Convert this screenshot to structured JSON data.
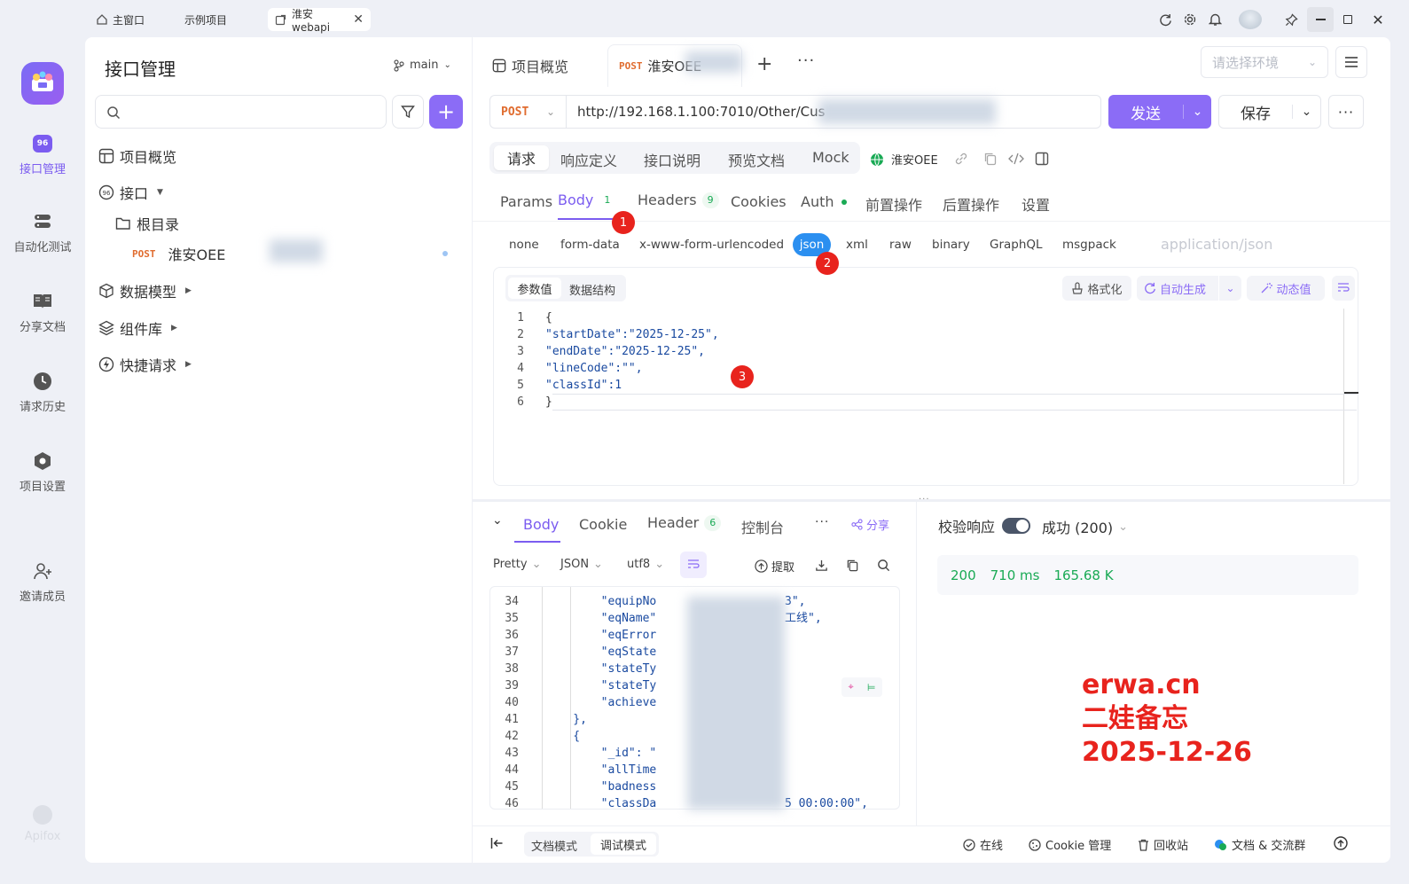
{
  "titlebar": {
    "tabs": [
      {
        "label": "主窗口"
      },
      {
        "label": "示例项目"
      },
      {
        "label": "淮安webapi"
      }
    ]
  },
  "rail": {
    "items": [
      {
        "label": "接口管理",
        "icon": "api-icon"
      },
      {
        "label": "自动化测试",
        "icon": "database-icon"
      },
      {
        "label": "分享文档",
        "icon": "book-icon"
      },
      {
        "label": "请求历史",
        "icon": "clock-icon"
      },
      {
        "label": "项目设置",
        "icon": "hexagon-icon"
      },
      {
        "label": "邀请成员",
        "icon": "add-user-icon"
      }
    ],
    "brand": "Apifox",
    "api_badge": "96"
  },
  "sidebar": {
    "title": "接口管理",
    "branch": "main",
    "tree": {
      "overview": "项目概览",
      "api": "接口",
      "root": "根目录",
      "request_method": "POST",
      "request_name": "淮安OEE",
      "data_model": "数据模型",
      "components": "组件库",
      "quick": "快捷请求"
    }
  },
  "top": {
    "overview_tab": "项目概览",
    "active_tab_method": "POST",
    "active_tab_name": "淮安OEE",
    "env_placeholder": "请选择环境"
  },
  "request": {
    "method": "POST",
    "url": "http://192.168.1.100:7010/Other/Cus",
    "send": "发送",
    "save": "保存",
    "mode_tabs": [
      "请求",
      "响应定义",
      "接口说明",
      "预览文档",
      "Mock"
    ],
    "env_name": "淮安OEE",
    "param_tabs": {
      "params": "Params",
      "body": "Body",
      "body_count": "1",
      "headers": "Headers",
      "headers_count": "9",
      "cookies": "Cookies",
      "auth": "Auth",
      "pre": "前置操作",
      "post": "后置操作",
      "settings": "设置"
    },
    "body_types": [
      "none",
      "form-data",
      "x-www-form-urlencoded",
      "json",
      "xml",
      "raw",
      "binary",
      "GraphQL",
      "msgpack"
    ],
    "content_type": "application/json",
    "editor_tabs": {
      "values": "参数值",
      "schema": "数据结构"
    },
    "editor_tools": {
      "format": "格式化",
      "auto": "自动生成",
      "dynamic": "动态值"
    },
    "code": [
      {
        "n": "1",
        "t": "{"
      },
      {
        "n": "2",
        "t": "\"startDate\":\"2025-12-25\","
      },
      {
        "n": "3",
        "t": "\"endDate\":\"2025-12-25\","
      },
      {
        "n": "4",
        "t": "\"lineCode\":\"\","
      },
      {
        "n": "5",
        "t": "\"classId\":1"
      },
      {
        "n": "6",
        "t": "}"
      }
    ]
  },
  "annotations": [
    "1",
    "2",
    "3"
  ],
  "response": {
    "tabs": {
      "body": "Body",
      "cookie": "Cookie",
      "header": "Header",
      "header_count": "6",
      "console": "控制台",
      "share": "分享"
    },
    "options": {
      "pretty": "Pretty",
      "format": "JSON",
      "encoding": "utf8",
      "extract": "提取"
    },
    "code": [
      {
        "n": "34",
        "t": "        \"equipNo",
        "tail": "3\","
      },
      {
        "n": "35",
        "t": "        \"eqName\"",
        "tail": "工线\","
      },
      {
        "n": "36",
        "t": "        \"eqError",
        "tail": ""
      },
      {
        "n": "37",
        "t": "        \"eqState",
        "tail": ""
      },
      {
        "n": "38",
        "t": "        \"stateTy",
        "tail": ""
      },
      {
        "n": "39",
        "t": "        \"stateTy",
        "tail": ""
      },
      {
        "n": "40",
        "t": "        \"achieve",
        "tail": ""
      },
      {
        "n": "41",
        "t": "    },",
        "tail": ""
      },
      {
        "n": "42",
        "t": "    {",
        "tail": ""
      },
      {
        "n": "43",
        "t": "        \"_id\": \"",
        "tail": ""
      },
      {
        "n": "44",
        "t": "        \"allTime",
        "tail": ""
      },
      {
        "n": "45",
        "t": "        \"badness",
        "tail": ""
      },
      {
        "n": "46",
        "t": "        \"classDa",
        "tail": "5 00:00:00\","
      }
    ],
    "verify_label": "校验响应",
    "status_select": "成功 (200)",
    "status_code": "200",
    "time": "710 ms",
    "size": "165.68 K"
  },
  "watermark": [
    "erwa.cn",
    "二娃备忘",
    "2025-12-26"
  ],
  "footer": {
    "doc_mode": "文档模式",
    "debug_mode": "调试模式",
    "online": "在线",
    "cookie": "Cookie 管理",
    "trash": "回收站",
    "community": "文档 & 交流群"
  },
  "colors": {
    "accent": "#8b6cf6",
    "post": "#e06c2f",
    "badge": "#e8231d",
    "watermark": "#e8231d",
    "json_chip": "#2b8ff0"
  }
}
